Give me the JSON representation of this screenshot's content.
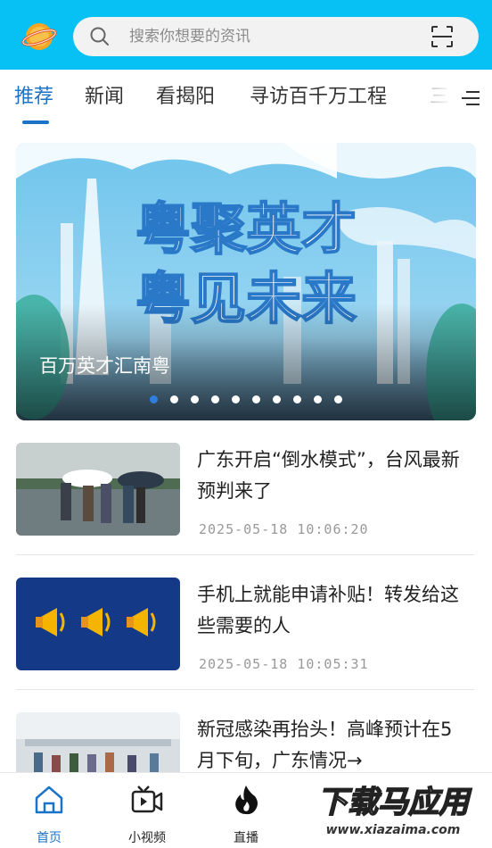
{
  "header": {
    "logo_icon": "app-logo-icon",
    "search_placeholder": "搜索你想要的资讯",
    "scan_icon": "scan-icon"
  },
  "tabs": [
    {
      "label": "推荐",
      "active": true
    },
    {
      "label": "新闻"
    },
    {
      "label": "看揭阳"
    },
    {
      "label": "寻访百千万工程"
    },
    {
      "label": "三"
    }
  ],
  "banner": {
    "headline_line1": "粤聚英才",
    "headline_line2": "粤见未来",
    "caption": "百万英才汇南粤",
    "dot_count": 10,
    "active_dot": 0
  },
  "news": [
    {
      "title": "广东开启“倒水模式”，台风最新预判来了",
      "time": "2025-05-18  10:06:20",
      "thumb": "rain-street-photo"
    },
    {
      "title": "手机上就能申请补贴！转发给这些需要的人",
      "time": "2025-05-18  10:05:31",
      "thumb": "megaphone-icons"
    },
    {
      "title": "新冠感染再抬头！高峰预计在5月下旬，广东情况→",
      "time": "",
      "thumb": "hospital-hall-photo"
    }
  ],
  "bottom_nav": [
    {
      "label": "首页",
      "icon": "home-icon",
      "active": true
    },
    {
      "label": "小视频",
      "icon": "video-icon"
    },
    {
      "label": "直播",
      "icon": "live-flame-icon"
    },
    {
      "label": "",
      "icon": "service-icon"
    },
    {
      "label": "",
      "icon": "profile-icon"
    }
  ],
  "watermark": {
    "line1": "下载马应用",
    "line2": "www.xiazaima.com"
  },
  "colors": {
    "header_bg": "#08c1f4",
    "accent": "#1a73c8"
  }
}
